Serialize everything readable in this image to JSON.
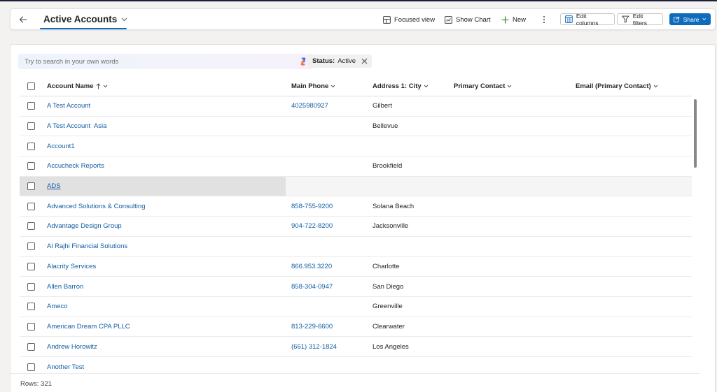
{
  "header": {
    "view_title": "Active Accounts",
    "commands": {
      "focused_view": "Focused view",
      "show_chart": "Show Chart",
      "new": "New",
      "edit_columns": "Edit columns",
      "edit_filters": "Edit filters",
      "share": "Share"
    }
  },
  "search": {
    "placeholder": "Try to search in your own words",
    "value": ""
  },
  "filter": {
    "label": "Status:",
    "value": "Active"
  },
  "grid": {
    "columns": [
      "Account Name",
      "Main Phone",
      "Address 1: City",
      "Primary Contact",
      "Email (Primary Contact)"
    ],
    "sort": {
      "column": "Account Name",
      "direction": "ascending"
    },
    "rows": [
      {
        "name": "A Test Account",
        "phone": "4025980927",
        "city": "Gilbert",
        "contact": "",
        "email": ""
      },
      {
        "name": "A Test Account  Asia",
        "phone": "",
        "city": "Bellevue",
        "contact": "",
        "email": ""
      },
      {
        "name": "Account1",
        "phone": "",
        "city": "",
        "contact": "",
        "email": ""
      },
      {
        "name": "Accucheck Reports",
        "phone": "",
        "city": "Brookfield",
        "contact": "",
        "email": ""
      },
      {
        "name": "ADS",
        "phone": "",
        "city": "",
        "contact": "",
        "email": "",
        "hovered": true
      },
      {
        "name": "Advanced Solutions & Consulting",
        "phone": "858-755-9200",
        "city": "Solana Beach",
        "contact": "",
        "email": ""
      },
      {
        "name": "Advantage Design Group",
        "phone": "904-722-8200",
        "city": "Jacksonville",
        "contact": "",
        "email": ""
      },
      {
        "name": "Al Rajhi Financial Solutions",
        "phone": "",
        "city": "",
        "contact": "",
        "email": ""
      },
      {
        "name": "Alacrity Services",
        "phone": "866.953.3220",
        "city": "Charlotte",
        "contact": "",
        "email": ""
      },
      {
        "name": "Allen Barron",
        "phone": "858-304-0947",
        "city": "San Diego",
        "contact": "",
        "email": ""
      },
      {
        "name": "Ameco",
        "phone": "",
        "city": "Greenville",
        "contact": "",
        "email": ""
      },
      {
        "name": "American Dream CPA PLLC",
        "phone": "813-229-6600",
        "city": "Clearwater",
        "contact": "",
        "email": ""
      },
      {
        "name": "Andrew Horowitz",
        "phone": "(661) 312-1824",
        "city": "Los Angeles",
        "contact": "",
        "email": ""
      },
      {
        "name": "Another Test",
        "phone": "",
        "city": "",
        "contact": "",
        "email": ""
      }
    ]
  },
  "footer": {
    "rows_count": "Rows: 321"
  },
  "colors": {
    "accent": "#0f6cbd",
    "link": "#115ea3",
    "border": "#e1dfdd",
    "background": "#f3f2f1"
  },
  "icons": {
    "back": "arrow-left-icon",
    "view_selector": "chevron-down-icon",
    "focused_view": "focused-view-icon",
    "show_chart": "chart-icon",
    "new": "plus-icon",
    "more": "more-vertical-icon",
    "edit_columns": "edit-columns-icon",
    "edit_filters": "filter-icon",
    "share": "share-icon",
    "copilot": "copilot-icon",
    "remove_filter": "close-icon",
    "sort": "arrow-up-icon"
  }
}
